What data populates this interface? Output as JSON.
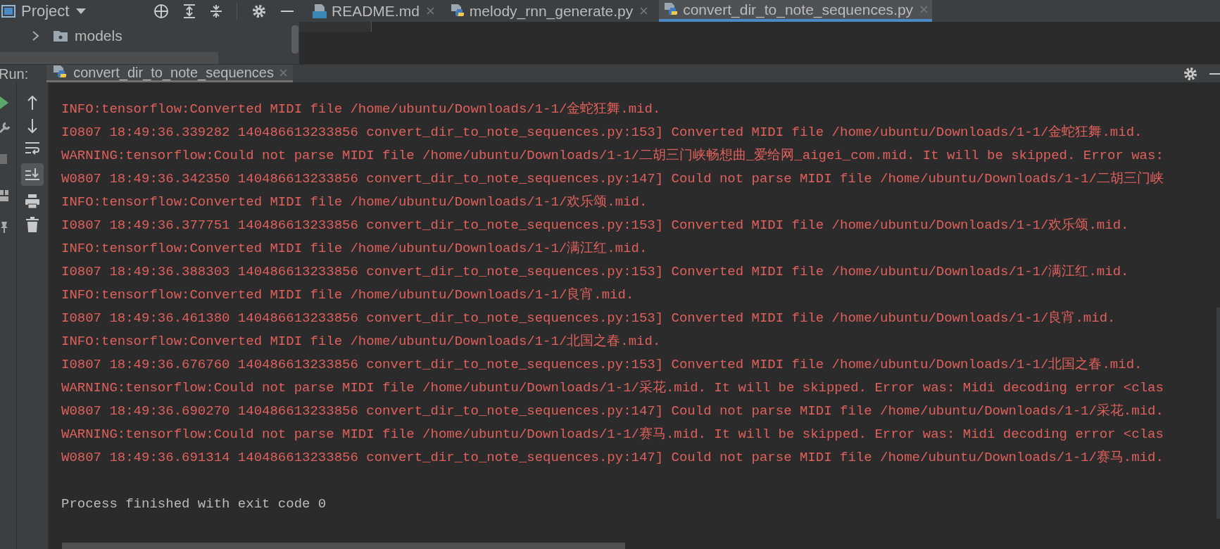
{
  "project_panel": {
    "title": "Project",
    "items": [
      {
        "label": "models",
        "expanded": false
      }
    ]
  },
  "editor_tabs": [
    {
      "label": "README.md",
      "kind": "markdown",
      "selected": false
    },
    {
      "label": "melody_rnn_generate.py",
      "kind": "python",
      "selected": false
    },
    {
      "label": "convert_dir_to_note_sequences.py",
      "kind": "python",
      "selected": true
    }
  ],
  "run_panel": {
    "label": "Run:",
    "tab": {
      "label": "convert_dir_to_note_sequences",
      "selected": true
    },
    "scroll_to_end": {
      "on": true
    }
  },
  "console": [
    {
      "kind": "stderr",
      "text": "INFO:tensorflow:Converted MIDI file /home/ubuntu/Downloads/1-1/金蛇狂舞.mid."
    },
    {
      "kind": "stderr",
      "text": "I0807 18:49:36.339282 140486613233856 convert_dir_to_note_sequences.py:153] Converted MIDI file /home/ubuntu/Downloads/1-1/金蛇狂舞.mid."
    },
    {
      "kind": "stderr",
      "text": "WARNING:tensorflow:Could not parse MIDI file /home/ubuntu/Downloads/1-1/二胡三门峡畅想曲_爱给网_aigei_com.mid. It will be skipped. Error was:"
    },
    {
      "kind": "stderr",
      "text": "W0807 18:49:36.342350 140486613233856 convert_dir_to_note_sequences.py:147] Could not parse MIDI file /home/ubuntu/Downloads/1-1/二胡三门峡"
    },
    {
      "kind": "stderr",
      "text": "INFO:tensorflow:Converted MIDI file /home/ubuntu/Downloads/1-1/欢乐颂.mid."
    },
    {
      "kind": "stderr",
      "text": "I0807 18:49:36.377751 140486613233856 convert_dir_to_note_sequences.py:153] Converted MIDI file /home/ubuntu/Downloads/1-1/欢乐颂.mid."
    },
    {
      "kind": "stderr",
      "text": "INFO:tensorflow:Converted MIDI file /home/ubuntu/Downloads/1-1/满江红.mid."
    },
    {
      "kind": "stderr",
      "text": "I0807 18:49:36.388303 140486613233856 convert_dir_to_note_sequences.py:153] Converted MIDI file /home/ubuntu/Downloads/1-1/满江红.mid."
    },
    {
      "kind": "stderr",
      "text": "INFO:tensorflow:Converted MIDI file /home/ubuntu/Downloads/1-1/良宵.mid."
    },
    {
      "kind": "stderr",
      "text": "I0807 18:49:36.461380 140486613233856 convert_dir_to_note_sequences.py:153] Converted MIDI file /home/ubuntu/Downloads/1-1/良宵.mid."
    },
    {
      "kind": "stderr",
      "text": "INFO:tensorflow:Converted MIDI file /home/ubuntu/Downloads/1-1/北国之春.mid."
    },
    {
      "kind": "stderr",
      "text": "I0807 18:49:36.676760 140486613233856 convert_dir_to_note_sequences.py:153] Converted MIDI file /home/ubuntu/Downloads/1-1/北国之春.mid."
    },
    {
      "kind": "stderr",
      "text": "WARNING:tensorflow:Could not parse MIDI file /home/ubuntu/Downloads/1-1/采花.mid. It will be skipped. Error was: Midi decoding error <clas"
    },
    {
      "kind": "stderr",
      "text": "W0807 18:49:36.690270 140486613233856 convert_dir_to_note_sequences.py:147] Could not parse MIDI file /home/ubuntu/Downloads/1-1/采花.mid."
    },
    {
      "kind": "stderr",
      "text": "WARNING:tensorflow:Could not parse MIDI file /home/ubuntu/Downloads/1-1/赛马.mid. It will be skipped. Error was: Midi decoding error <clas"
    },
    {
      "kind": "stderr",
      "text": "W0807 18:49:36.691314 140486613233856 convert_dir_to_note_sequences.py:147] Could not parse MIDI file /home/ubuntu/Downloads/1-1/赛马.mid."
    },
    {
      "kind": "blank"
    },
    {
      "kind": "stdout",
      "text": "Process finished with exit code 0"
    }
  ]
}
